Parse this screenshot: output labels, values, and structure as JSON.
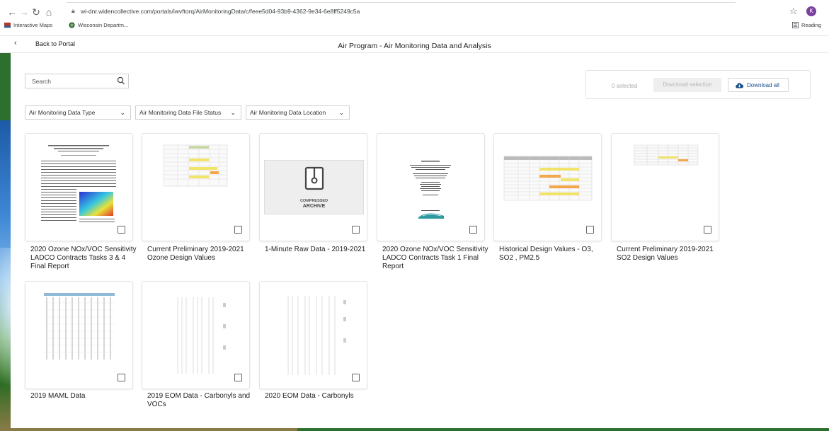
{
  "browser": {
    "url": "wi-dnr.widencollective.com/portals/iwvftorq/AirMonitoringData/c/feee5d04-93b9-4362-9e34-6e8ff5249c5a",
    "avatar_initial": "K",
    "bookmarks": [
      "Interactive Maps",
      "Wisconsin Departm..."
    ],
    "reading_list": "Reading"
  },
  "header": {
    "back_label": "Back to Portal",
    "title": "Air Program - Air Monitoring Data and Analysis"
  },
  "search": {
    "placeholder": "Search"
  },
  "download": {
    "selected_text": "0 selected",
    "selection_label": "Download selection",
    "all_label": "Download all"
  },
  "filters": [
    "Air Monitoring Data Type",
    "Air Monitoring Data File Status",
    "Air Monitoring Data Location"
  ],
  "assets": [
    {
      "title": "2020 Ozone NOx/VOC Sensitivity LADCO Contracts Tasks 3 & 4 Final Report",
      "thumb": "report-with-map"
    },
    {
      "title": "Current Preliminary 2019-2021 Ozone Design Values",
      "thumb": "spreadsheet"
    },
    {
      "title": "1-Minute Raw Data - 2019-2021",
      "thumb": "compressed-archive",
      "archive_label_1": "COMPRESSED",
      "archive_label_2": "ARCHIVE"
    },
    {
      "title": "2020 Ozone NOx/VOC Sensitivity LADCO Contracts Task 1 Final Report",
      "thumb": "report-cover"
    },
    {
      "title": "Historical Design Values - O3, SO2 , PM2.5",
      "thumb": "spreadsheet"
    },
    {
      "title": "Current Preliminary 2019-2021 SO2 Design Values",
      "thumb": "spreadsheet-small"
    },
    {
      "title": "2019 MAML Data",
      "thumb": "data-columns"
    },
    {
      "title": "2019 EOM Data - Carbonyls and VOCs",
      "thumb": "data-text"
    },
    {
      "title": "2020 EOM Data - Carbonyls",
      "thumb": "data-text"
    }
  ],
  "colors": {
    "accent": "#1a4f8b",
    "avatar": "#7b3fa0"
  }
}
